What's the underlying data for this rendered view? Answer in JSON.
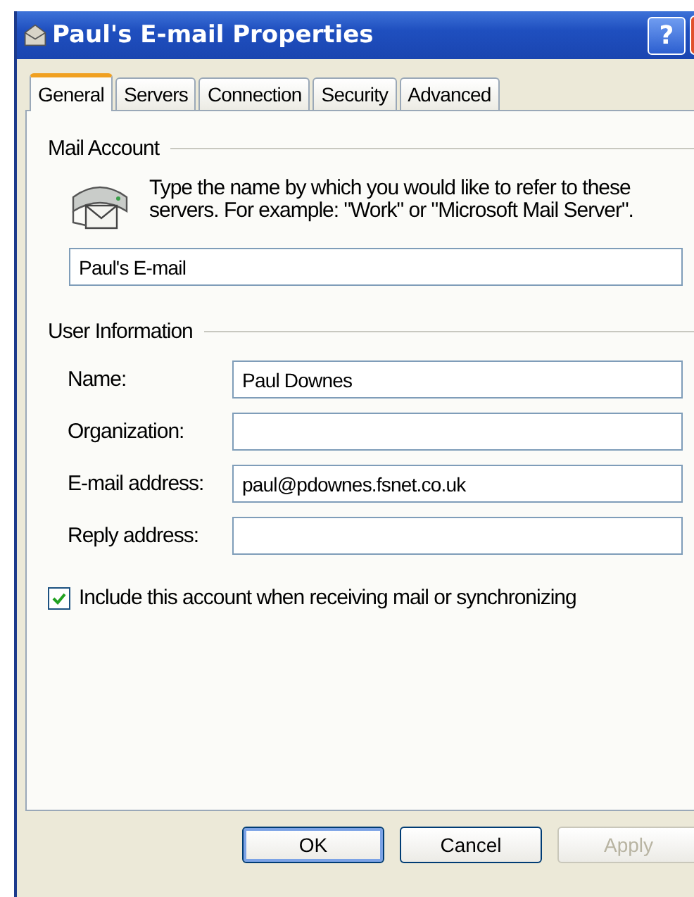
{
  "window": {
    "title": "Paul's E-mail Properties",
    "help_label": "?"
  },
  "tabs": [
    {
      "label": "General",
      "selected": true
    },
    {
      "label": "Servers",
      "selected": false
    },
    {
      "label": "Connection",
      "selected": false
    },
    {
      "label": "Security",
      "selected": false
    },
    {
      "label": "Advanced",
      "selected": false
    }
  ],
  "mail_account": {
    "heading": "Mail Account",
    "description": "Type the name by which you would like to refer to these servers.  For example: \"Work\" or \"Microsoft Mail Server\".",
    "value": "Paul's E-mail"
  },
  "user_information": {
    "heading": "User Information",
    "fields": [
      {
        "label": "Name:",
        "value": "Paul Downes"
      },
      {
        "label": "Organization:"
      },
      {
        "label": "E-mail address:",
        "value": "paul@pdownes.fsnet.co.uk"
      },
      {
        "label": "Reply address:"
      }
    ]
  },
  "include_account": {
    "label": "Include this account when receiving mail or synchronizing",
    "checked": true
  },
  "buttons": [
    {
      "label": "OK",
      "default": true,
      "disabled": false
    },
    {
      "label": "Cancel",
      "default": false,
      "disabled": false
    },
    {
      "label": "Apply",
      "default": false,
      "disabled": true
    }
  ]
}
